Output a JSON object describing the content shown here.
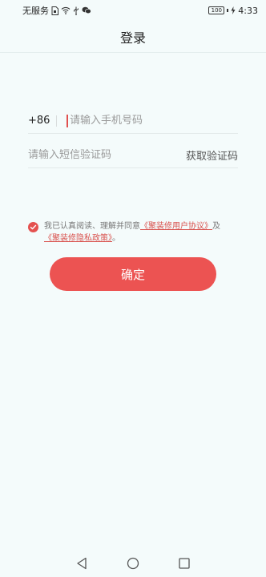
{
  "status_bar": {
    "carrier": "无服务",
    "battery": "100",
    "time": "4:33"
  },
  "header": {
    "title": "登录"
  },
  "form": {
    "country_code": "+86",
    "phone_placeholder": "请输入手机号码",
    "code_placeholder": "请输入短信验证码",
    "get_code_label": "获取验证码"
  },
  "agreement": {
    "prefix": "我已认真阅读、理解并同意",
    "user_agreement": "《聚装修用户协议》",
    "conjunction": "及",
    "privacy_policy": "《聚装修隐私政策》",
    "suffix": "。",
    "checked": true
  },
  "confirm_label": "确定",
  "colors": {
    "accent": "#ec5352",
    "background": "#f4fbfb",
    "link": "#d9534f"
  },
  "nav_bar": {
    "icons": [
      "back-icon",
      "home-icon",
      "recents-icon"
    ]
  }
}
